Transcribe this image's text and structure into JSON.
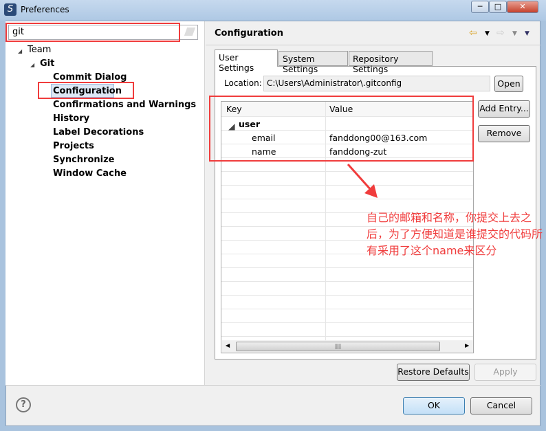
{
  "window": {
    "title": "Preferences",
    "minimize": "─",
    "maximize": "□",
    "close": "✕"
  },
  "search": {
    "value": "git"
  },
  "tree": [
    {
      "label": "Team",
      "level": 0,
      "bold": false
    },
    {
      "label": "Git",
      "level": 1,
      "bold": true
    },
    {
      "label": "Commit Dialog",
      "level": 2,
      "bold": true
    },
    {
      "label": "Configuration",
      "level": 2,
      "bold": true,
      "selected": true
    },
    {
      "label": "Confirmations and Warnings",
      "level": 2,
      "bold": true
    },
    {
      "label": "History",
      "level": 2,
      "bold": true
    },
    {
      "label": "Label Decorations",
      "level": 2,
      "bold": true
    },
    {
      "label": "Projects",
      "level": 2,
      "bold": true
    },
    {
      "label": "Synchronize",
      "level": 2,
      "bold": true
    },
    {
      "label": "Window Cache",
      "level": 2,
      "bold": true
    }
  ],
  "page": {
    "title": "Configuration"
  },
  "tabs": [
    "User Settings",
    "System Settings",
    "Repository Settings"
  ],
  "location": {
    "label": "Location:",
    "value": "C:\\Users\\Administrator\\.gitconfig",
    "open": "Open"
  },
  "table": {
    "headers": [
      "Key",
      "Value"
    ],
    "rows": [
      {
        "key": "user",
        "value": "",
        "section": true
      },
      {
        "key": "email",
        "value": "fanddong00@163.com"
      },
      {
        "key": "name",
        "value": "fanddong-zut"
      }
    ]
  },
  "buttons": {
    "add_entry": "Add Entry...",
    "remove": "Remove",
    "restore": "Restore Defaults",
    "apply": "Apply",
    "ok": "OK",
    "cancel": "Cancel",
    "help": "?"
  },
  "annotation": {
    "text": "自己的邮箱和名称，你提交上去之后，为了方便知道是谁提交的代码所有采用了这个name来区分",
    "color": "#f03c3c"
  }
}
